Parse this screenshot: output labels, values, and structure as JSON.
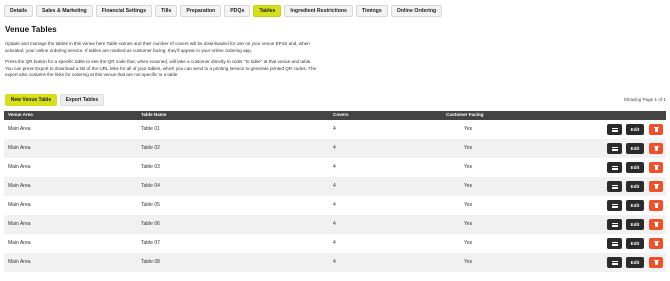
{
  "tabs": [
    {
      "label": "Details",
      "active": false
    },
    {
      "label": "Sales & Marketing",
      "active": false
    },
    {
      "label": "Financial Settings",
      "active": false
    },
    {
      "label": "Tills",
      "active": false
    },
    {
      "label": "Preparation",
      "active": false
    },
    {
      "label": "PDQs",
      "active": false
    },
    {
      "label": "Tables",
      "active": true
    },
    {
      "label": "Ingredient Restrictions",
      "active": false
    },
    {
      "label": "Timings",
      "active": false
    },
    {
      "label": "Online Ordering",
      "active": false
    }
  ],
  "page": {
    "title": "Venue Tables",
    "description_1": "Update and manage the tables in this venue here Table names and their number of covers will be downloaded for use on your venue EPoS and, when activated, your online ordering service. If tables are marked as customer facing, they'll appear in your online ordering app.",
    "description_2": "Press the QR button for a specific table to see the QR code that, when scanned, will take a customer directly to order \"to table\" at that venue and table. You can press Export to download a list of the URL links for all of your tables, which you can send to a printing service to generate printed QR codes. The export also contains the links for ordering at this venue that are not specific to a table."
  },
  "toolbar": {
    "new_label": "New Venue Table",
    "export_label": "Export Tables",
    "showing": "Showing Page 1 of 1"
  },
  "table": {
    "headers": [
      "Venue Area",
      "Table Name",
      "Covers",
      "Customer Facing"
    ],
    "rows": [
      {
        "area": "Main Area",
        "name": "Table 01",
        "covers": "4",
        "customer": "Yes"
      },
      {
        "area": "Main Area",
        "name": "Table 02",
        "covers": "4",
        "customer": "Yes"
      },
      {
        "area": "Main Area",
        "name": "Table 03",
        "covers": "4",
        "customer": "Yes"
      },
      {
        "area": "Main Area",
        "name": "Table 04",
        "covers": "4",
        "customer": "Yes"
      },
      {
        "area": "Main Area",
        "name": "Table 05",
        "covers": "4",
        "customer": "Yes"
      },
      {
        "area": "Main Area",
        "name": "Table 06",
        "covers": "4",
        "customer": "Yes"
      },
      {
        "area": "Main Area",
        "name": "Table 07",
        "covers": "4",
        "customer": "Yes"
      },
      {
        "area": "Main Area",
        "name": "Table 08",
        "covers": "4",
        "customer": "Yes"
      }
    ],
    "edit_label": "Edit",
    "qr_icon": "qr-icon",
    "delete_icon": "trash-icon"
  },
  "colors": {
    "accent": "#d6e01a",
    "header_bg": "#444444",
    "dark_button": "#2b2b2b",
    "delete_button": "#f0502a"
  }
}
